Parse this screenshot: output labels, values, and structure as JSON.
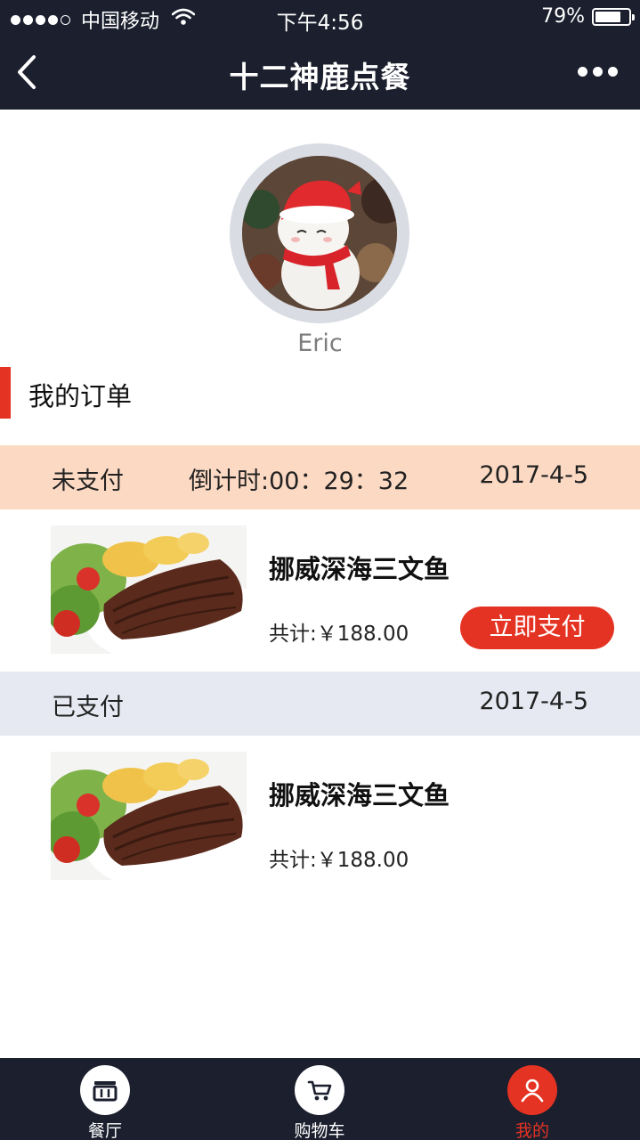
{
  "status_bar": {
    "carrier": "中国移动",
    "time": "下午4:56",
    "battery_percent": "79%",
    "battery_level": 0.79,
    "signal_bars_filled": 4,
    "signal_bars_total": 5
  },
  "nav": {
    "title": "十二神鹿点餐",
    "back_icon": "chevron-left-icon",
    "more_icon": "ellipsis-icon"
  },
  "profile": {
    "username": "Eric"
  },
  "section": {
    "title": "我的订单"
  },
  "orders": [
    {
      "status": "未支付",
      "countdown": "倒计时:00：29：32",
      "date": "2017-4-5",
      "item_name": "挪威深海三文鱼",
      "total": "共计:￥188.00",
      "pay_label": "立即支付"
    },
    {
      "status": "已支付",
      "date": "2017-4-5",
      "item_name": "挪威深海三文鱼",
      "total": "共计:￥188.00"
    }
  ],
  "tabbar": {
    "items": [
      {
        "label": "餐厅",
        "icon": "restaurant-icon"
      },
      {
        "label": "购物车",
        "icon": "cart-icon"
      },
      {
        "label": "我的",
        "icon": "user-icon",
        "active": true
      }
    ]
  },
  "colors": {
    "bar_bg": "#1b1f2e",
    "accent_red": "#e53323",
    "unpaid_header_bg": "#fcd9c3",
    "paid_header_bg": "#e6e9f1"
  }
}
